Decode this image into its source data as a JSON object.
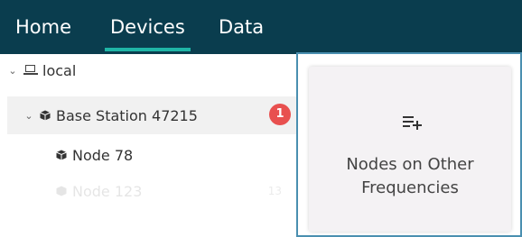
{
  "nav": {
    "tabs": [
      {
        "label": "Home"
      },
      {
        "label": "Devices"
      },
      {
        "label": "Data"
      }
    ],
    "active": "Devices",
    "colors": {
      "bar": "#0a3d4e",
      "underline": "#1fb5a6"
    }
  },
  "tree": {
    "local": {
      "label": "local",
      "icon": "laptop-icon",
      "expanded": true
    },
    "base_station": {
      "label": "Base Station 47215",
      "icon": "cube-icon",
      "expanded": true,
      "badge": "1"
    },
    "node": {
      "label": "Node 78",
      "icon": "cube-icon"
    },
    "faded_row": {
      "label": "Node 123",
      "count": "13"
    }
  },
  "panel": {
    "card": {
      "icon": "playlist-add-icon",
      "label_line1": "Nodes on Other",
      "label_line2": "Frequencies"
    },
    "colors": {
      "border": "#4a8fb0",
      "badge": "#e8504f"
    }
  }
}
